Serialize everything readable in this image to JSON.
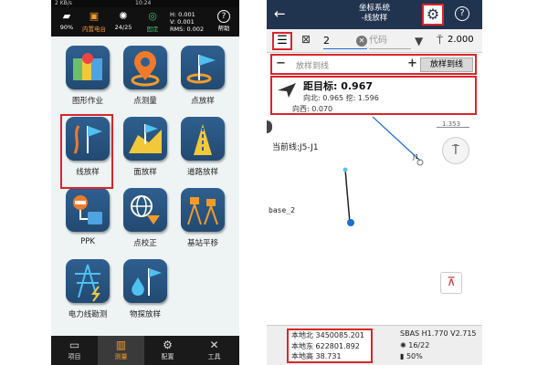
{
  "left": {
    "status_bar": {
      "speed": "2 KB/s",
      "time": "10:24"
    },
    "toolbar": [
      {
        "icon": "gps-icon",
        "glyph": "▰",
        "label": "90%"
      },
      {
        "icon": "radio-icon",
        "glyph": "▣",
        "label": "内置电台",
        "color": "#f29b2b"
      },
      {
        "icon": "satellite-icon",
        "glyph": "✺",
        "label": "24/25"
      },
      {
        "icon": "fix-icon",
        "glyph": "◎",
        "label": "固定",
        "color": "#3ec46d"
      },
      {
        "icon": "help-icon",
        "glyph": "?",
        "label": "帮助"
      }
    ],
    "precision": {
      "h": "H: 0.001",
      "v": "V: 0.001",
      "rms": "RMS: 0.002"
    },
    "tiles": [
      {
        "label": "图形作业"
      },
      {
        "label": "点测量"
      },
      {
        "label": "点放样"
      },
      {
        "label": "线放样"
      },
      {
        "label": "面放样"
      },
      {
        "label": "道路放样"
      },
      {
        "label": "PPK"
      },
      {
        "label": "点校正"
      },
      {
        "label": "基站平移"
      },
      {
        "label": "电力线勘测"
      },
      {
        "label": "物探放样"
      }
    ],
    "nav": [
      {
        "label": "项目",
        "glyph": "▭"
      },
      {
        "label": "测量",
        "glyph": "▥",
        "active": true
      },
      {
        "label": "配置",
        "glyph": "⚙"
      },
      {
        "label": "工具",
        "glyph": "✕"
      }
    ]
  },
  "right": {
    "header": {
      "title": "坐标系统",
      "subtitle": "-线放样",
      "back": "←",
      "gear": "⚙",
      "help": "?"
    },
    "toolbar": {
      "point_value": "2",
      "code_placeholder": "代码",
      "height": "2.000"
    },
    "stakeout": {
      "minus": "−",
      "plus": "+",
      "placeholder": "放样到线",
      "button": "放样到线"
    },
    "info": {
      "distance": "距目标: 0.967",
      "north_dig": "向北: 0.965 挖: 1.596",
      "west": "向西: 0.070"
    },
    "map": {
      "scale": "1.353",
      "current_line": "当前线:J5-J1",
      "point_label": "J1",
      "base_label": "base_2"
    },
    "status": {
      "north": "本地北 3450085.201",
      "east": "本地东 622801.892",
      "height": "本地高 38.731",
      "sbas": "SBAS H1.770 V2.715",
      "sats": "16/22",
      "battery": "50%"
    }
  }
}
